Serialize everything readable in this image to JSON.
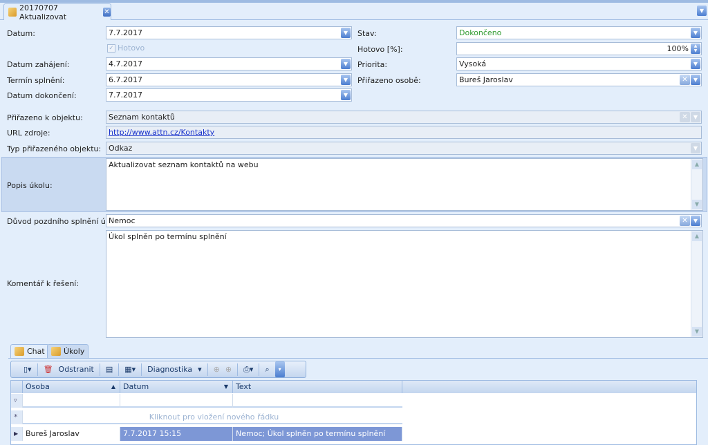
{
  "tab": {
    "title": "20170707 Aktualizovat"
  },
  "left": {
    "datum": {
      "label": "Datum:",
      "value": "7.7.2017"
    },
    "hotovo_check": {
      "label": "Hotovo",
      "checked": true
    },
    "zahajeni": {
      "label": "Datum zahájení:",
      "value": "4.7.2017"
    },
    "termin": {
      "label": "Termín splnění:",
      "value": "6.7.2017"
    },
    "dokonceni": {
      "label": "Datum dokončení:",
      "value": "7.7.2017"
    }
  },
  "right": {
    "stav": {
      "label": "Stav:",
      "value": "Dokončeno",
      "color": "#2e9a2e"
    },
    "hotovo_pct": {
      "label": "Hotovo [%]:",
      "value": "100%"
    },
    "priorita": {
      "label": "Priorita:",
      "value": "Vysoká"
    },
    "prirazeno": {
      "label": "Přiřazeno osobě:",
      "value": "Bureš Jaroslav"
    }
  },
  "objekt": {
    "label": "Přiřazeno k objektu:",
    "value": "Seznam kontaktů"
  },
  "url": {
    "label": "URL zdroje:",
    "value": "http://www.attn.cz/Kontakty"
  },
  "typ": {
    "label": "Typ přiřazeného objektu:",
    "value": "Odkaz"
  },
  "popis": {
    "label": "Popis úkolu:",
    "value": "Aktualizovat seznam kontaktů na webu"
  },
  "duvod": {
    "label": "Důvod pozdního splnění úkolu:",
    "value": "Nemoc"
  },
  "komentar": {
    "label": "Komentář k řešení:",
    "value": "Úkol splněn po termínu splnění"
  },
  "bottom_tabs": [
    {
      "label": "Chat"
    },
    {
      "label": "Úkoly"
    }
  ],
  "toolbar": {
    "delete": "Odstranit",
    "diagnostika": "Diagnostika"
  },
  "grid": {
    "columns": [
      "Osoba",
      "Datum",
      "Text"
    ],
    "new_row": "Kliknout pro vložení nového řádku",
    "rows": [
      {
        "osoba": "Bureš Jaroslav",
        "datum": "7.7.2017 15:15",
        "text": "Nemoc; Úkol splněn po termínu splnění"
      }
    ]
  }
}
